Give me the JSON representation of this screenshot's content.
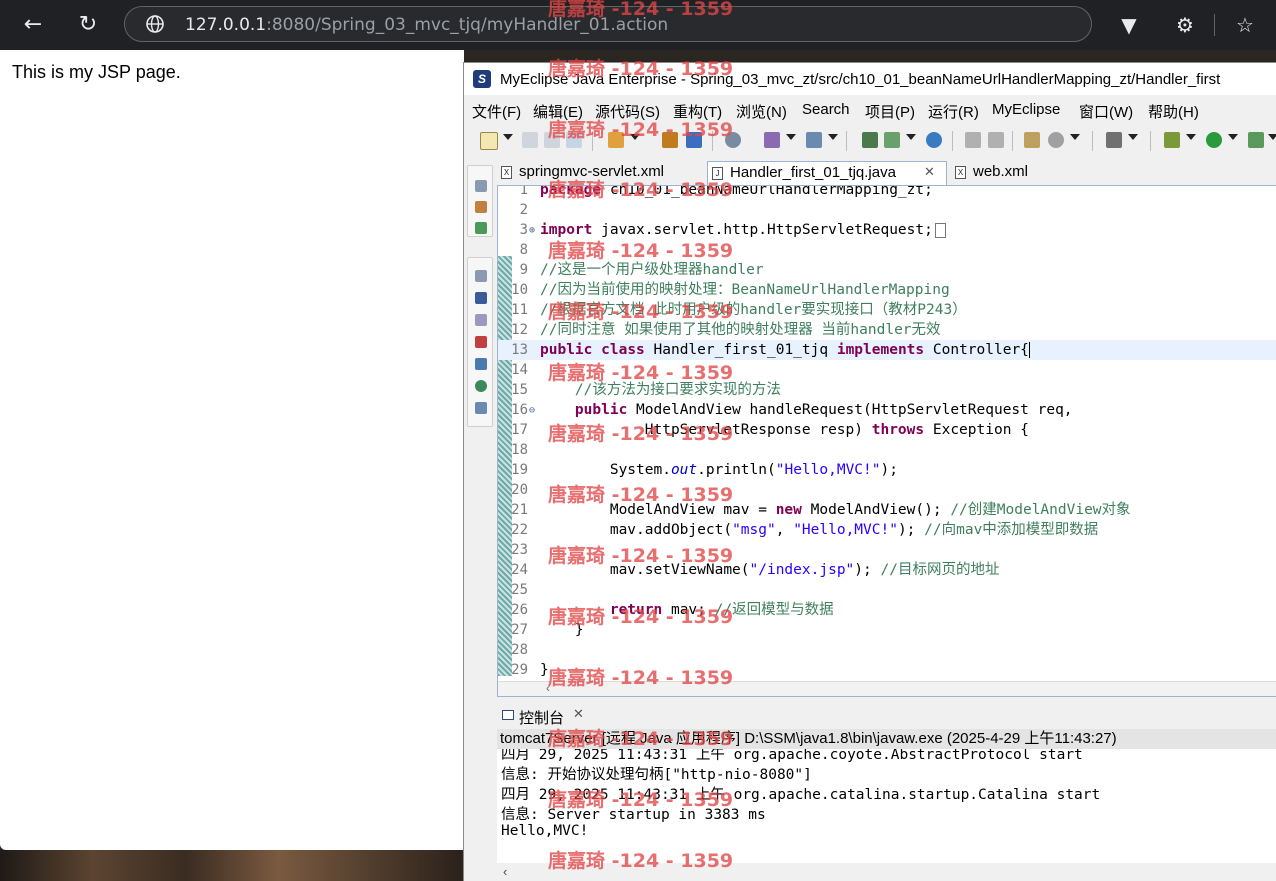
{
  "browser": {
    "back_icon": "back-arrow-icon",
    "reload_icon": "reload-icon",
    "url_host": "127.0.0.1",
    "url_rest": ":8080/Spring_03_mvc_tjq/myHandler_01.action",
    "page_text": "This is my JSP page."
  },
  "eclipse": {
    "title": "MyEclipse Java Enterprise  -  Spring_03_mvc_zt/src/ch10_01_beanNameUrlHandlerMapping_zt/Handler_first",
    "menu": [
      "文件(F)",
      "编辑(E)",
      "源代码(S)",
      "重构(T)",
      "浏览(N)",
      "Search",
      "项目(P)",
      "运行(R)",
      "MyEclipse",
      "窗口(W)",
      "帮助(H)"
    ],
    "tabs": [
      {
        "label": "springmvc-servlet.xml",
        "icon": "X"
      },
      {
        "label": "Handler_first_01_tjq.java",
        "icon": "J"
      },
      {
        "label": "web.xml",
        "icon": "X"
      }
    ],
    "code_lines": [
      {
        "n": "1",
        "t": "package ch10_01_beanNameUrlHandlerMapping_zt;"
      },
      {
        "n": "2",
        "t": ""
      },
      {
        "n": "3",
        "t": "import javax.servlet.http.HttpServletRequest;"
      },
      {
        "n": "8",
        "t": ""
      },
      {
        "n": "9",
        "t": "//这是一个用户级处理器handler"
      },
      {
        "n": "10",
        "t": "//因为当前使用的映射处理：BeanNameUrlHandlerMapping"
      },
      {
        "n": "11",
        "t": "//根据官方文档 此时用户级的handler要实现接口（教材P243）"
      },
      {
        "n": "12",
        "t": "//同时注意 如果使用了其他的映射处理器 当前handler无效"
      },
      {
        "n": "13",
        "t": "public class Handler_first_01_tjq implements Controller{"
      },
      {
        "n": "14",
        "t": ""
      },
      {
        "n": "15",
        "t": "    //该方法为接口要求实现的方法"
      },
      {
        "n": "16",
        "t": "    public ModelAndView handleRequest(HttpServletRequest req,"
      },
      {
        "n": "17",
        "t": "            HttpServletResponse resp) throws Exception {"
      },
      {
        "n": "18",
        "t": ""
      },
      {
        "n": "19",
        "t": "        System.out.println(\"Hello,MVC!\");"
      },
      {
        "n": "20",
        "t": ""
      },
      {
        "n": "21",
        "t": "        ModelAndView mav = new ModelAndView(); //创建ModelAndView对象"
      },
      {
        "n": "22",
        "t": "        mav.addObject(\"msg\", \"Hello,MVC!\"); //向mav中添加模型即数据"
      },
      {
        "n": "23",
        "t": ""
      },
      {
        "n": "24",
        "t": "        mav.setViewName(\"/index.jsp\"); //目标网页的地址"
      },
      {
        "n": "25",
        "t": ""
      },
      {
        "n": "26",
        "t": "        return mav; //返回模型与数据"
      },
      {
        "n": "27",
        "t": "    }"
      },
      {
        "n": "28",
        "t": ""
      },
      {
        "n": "29",
        "t": "}"
      }
    ],
    "console": {
      "tab_label": "控制台",
      "header": "tomcat7Server [远程 Java 应用程序] D:\\SSM\\java1.8\\bin\\javaw.exe  (2025-4-29 上午11:43:27)",
      "lines": [
        "四月 29, 2025 11:43:31 上午 org.apache.coyote.AbstractProtocol start",
        "信息: 开始协议处理句柄[\"http-nio-8080\"]",
        "四月 29, 2025 11:43:31 上午 org.apache.catalina.startup.Catalina start",
        "信息: Server startup in 3383 ms",
        "Hello,MVC!"
      ]
    }
  },
  "watermark": "唐嘉琦 -124 - 1359"
}
